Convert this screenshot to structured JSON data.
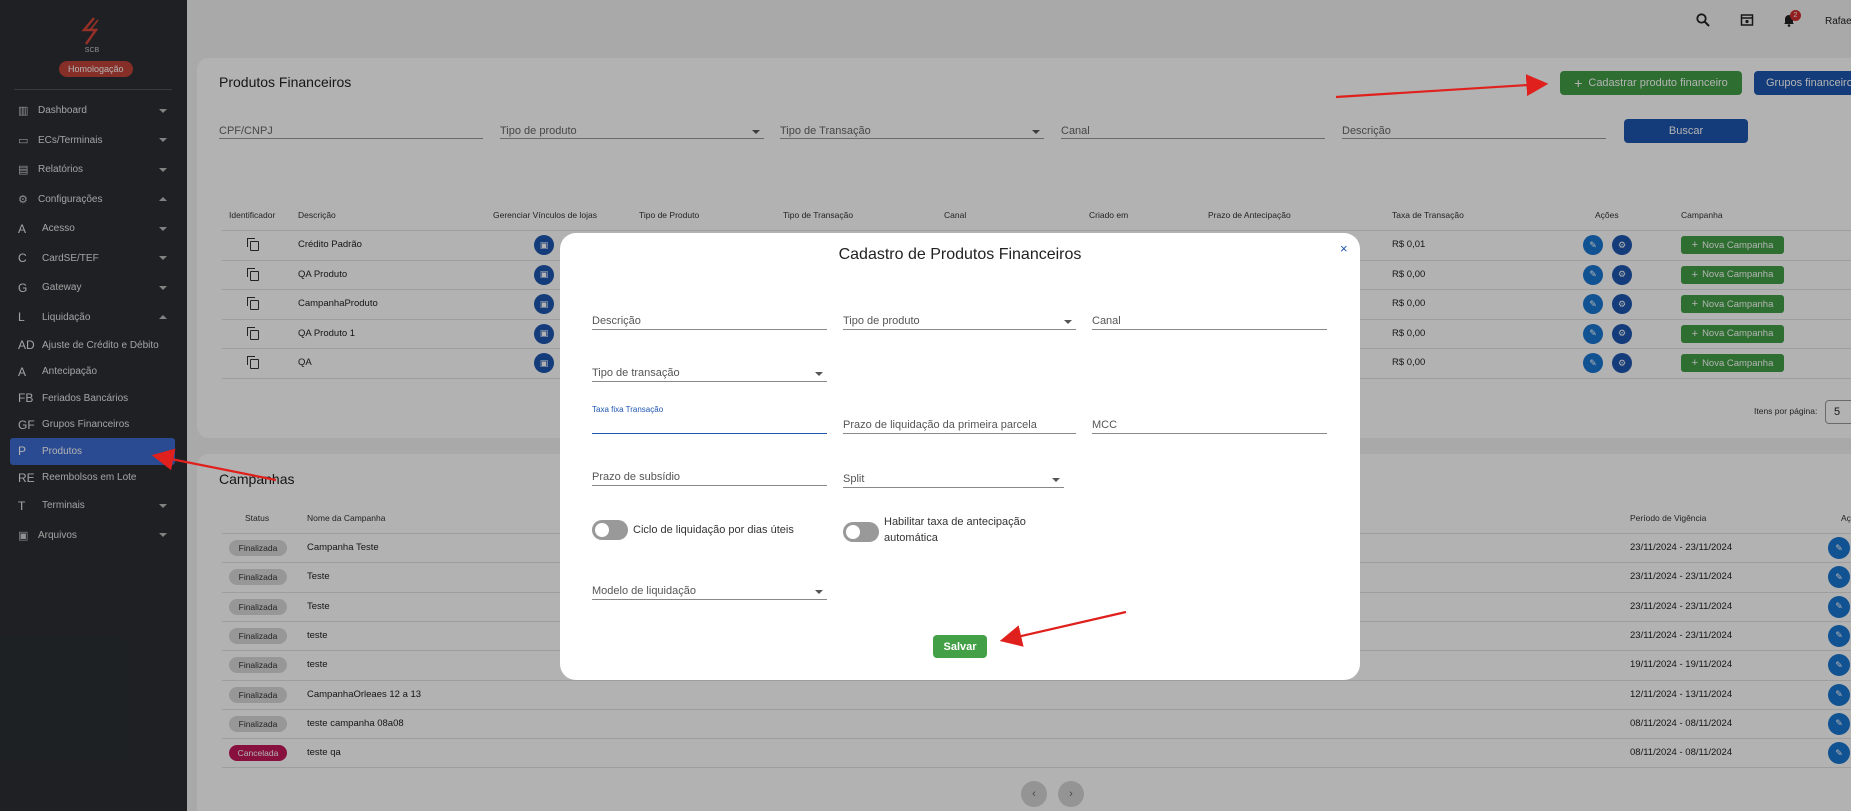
{
  "sidebar": {
    "env_badge": "Homologação",
    "items": [
      {
        "icon": "chart-icon",
        "abbr": "",
        "label": "Dashboard",
        "chev": "down"
      },
      {
        "icon": "terminal-icon",
        "abbr": "",
        "label": "ECs/Terminais",
        "chev": "down"
      },
      {
        "icon": "report-icon",
        "abbr": "",
        "label": "Relatórios",
        "chev": "down"
      },
      {
        "icon": "gear-icon",
        "abbr": "",
        "label": "Configurações",
        "chev": "up"
      },
      {
        "icon": "",
        "abbr": "A",
        "label": "Acesso",
        "chev": "down"
      },
      {
        "icon": "",
        "abbr": "C",
        "label": "CardSE/TEF",
        "chev": "down"
      },
      {
        "icon": "",
        "abbr": "G",
        "label": "Gateway",
        "chev": "down"
      },
      {
        "icon": "",
        "abbr": "L",
        "label": "Liquidação",
        "chev": "up"
      },
      {
        "icon": "",
        "abbr": "AD",
        "label": "Ajuste de Crédito e Débito"
      },
      {
        "icon": "",
        "abbr": "A",
        "label": "Antecipação"
      },
      {
        "icon": "",
        "abbr": "FB",
        "label": "Feriados Bancários"
      },
      {
        "icon": "",
        "abbr": "GF",
        "label": "Grupos Financeiros"
      },
      {
        "icon": "",
        "abbr": "P",
        "label": "Produtos",
        "active": true
      },
      {
        "icon": "",
        "abbr": "RE",
        "label": "Reembolsos em Lote"
      },
      {
        "icon": "",
        "abbr": "T",
        "label": "Terminais",
        "chev": "down"
      },
      {
        "icon": "archive-icon",
        "abbr": "",
        "label": "Arquivos",
        "chev": "down"
      }
    ]
  },
  "topbar": {
    "notif_count": "2",
    "user": "Rafae"
  },
  "products": {
    "title": "Produtos Financeiros",
    "add_button": "Cadastrar produto financeiro",
    "groups_button": "Grupos financeiros",
    "filters": {
      "cpf": "CPF/CNPJ",
      "tipo_produto": "Tipo de produto",
      "tipo_transacao": "Tipo de Transação",
      "canal": "Canal",
      "descricao": "Descrição"
    },
    "search_button": "Buscar",
    "columns": {
      "identificador": "Identificador",
      "descricao": "Descrição",
      "vinculos": "Gerenciar Vínculos de lojas",
      "tipo_produto": "Tipo de Produto",
      "tipo_transacao": "Tipo de Transação",
      "canal": "Canal",
      "criado": "Criado em",
      "prazo": "Prazo de Antecipação",
      "taxa": "Taxa de Transação",
      "acoes": "Ações",
      "campanha": "Campanha"
    },
    "rows": [
      {
        "descricao": "Crédito Padrão",
        "taxa": "R$ 0,01"
      },
      {
        "descricao": "QA Produto",
        "taxa": "R$ 0,00"
      },
      {
        "descricao": "CampanhaProduto",
        "taxa": "R$ 0,00"
      },
      {
        "descricao": "QA Produto 1",
        "taxa": "R$ 0,00"
      },
      {
        "descricao": "QA",
        "taxa": "R$ 0,00"
      }
    ],
    "nova_campanha": "Nova Campanha",
    "items_per_page_label": "Itens por página:",
    "items_per_page": "5"
  },
  "campaigns": {
    "title": "Campanhas",
    "columns": {
      "status": "Status",
      "nome": "Nome da Campanha",
      "periodo": "Período de Vigência",
      "acoes": "Aç"
    },
    "rows": [
      {
        "status": "Finalizada",
        "nome": "Campanha Teste",
        "periodo": "23/11/2024 - 23/11/2024"
      },
      {
        "status": "Finalizada",
        "nome": "Teste",
        "periodo": "23/11/2024 - 23/11/2024"
      },
      {
        "status": "Finalizada",
        "nome": "Teste",
        "periodo": "23/11/2024 - 23/11/2024"
      },
      {
        "status": "Finalizada",
        "nome": "teste",
        "periodo": "23/11/2024 - 23/11/2024"
      },
      {
        "status": "Finalizada",
        "nome": "teste",
        "periodo": "19/11/2024 - 19/11/2024"
      },
      {
        "status": "Finalizada",
        "nome": "CampanhaOrleaes 12 a 13",
        "periodo": "12/11/2024 - 13/11/2024"
      },
      {
        "status": "Finalizada",
        "nome": "teste campanha 08a08",
        "periodo": "08/11/2024 - 08/11/2024"
      },
      {
        "status": "Cancelada",
        "nome": "teste qa",
        "periodo": "08/11/2024 - 08/11/2024"
      }
    ]
  },
  "modal": {
    "title": "Cadastro de Produtos Financeiros",
    "close": "×",
    "fields": {
      "descricao": "Descrição",
      "tipo_produto": "Tipo de produto",
      "canal": "Canal",
      "tipo_transacao": "Tipo de transação",
      "taxa_fixa_label": "Taxa fixa Transação",
      "prazo_liquidacao": "Prazo de liquidação da primeira parcela",
      "mcc": "MCC",
      "prazo_subsidio": "Prazo de subsídio",
      "split": "Split",
      "modelo_liquidacao": "Modelo de liquidação"
    },
    "toggles": {
      "ciclo": "Ciclo de liquidação por dias úteis",
      "habilitar_line1": "Habilitar taxa de antecipação",
      "habilitar_line2": "automática"
    },
    "save_button": "Salvar"
  },
  "colors": {
    "primary": "#1e56b0",
    "success": "#43a047",
    "danger": "#c2185b",
    "sidebar": "#2b2f33",
    "annotation": "#e0201c"
  }
}
